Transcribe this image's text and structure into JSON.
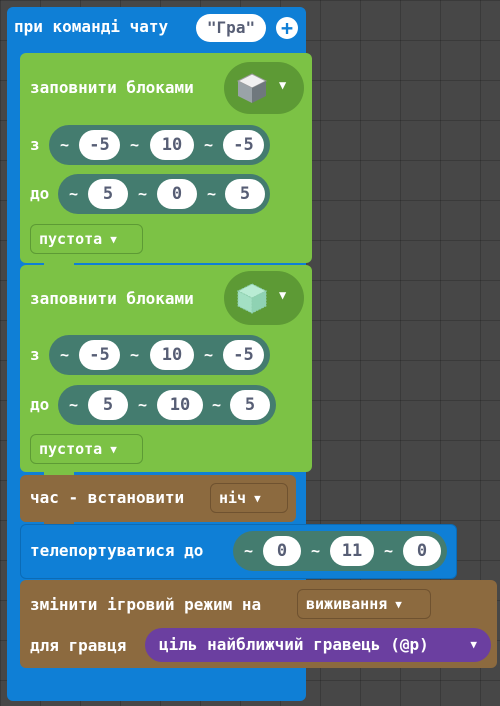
{
  "event": {
    "label": "при команді чату",
    "command": "Гра"
  },
  "fill1": {
    "label": "заповнити блоками",
    "block_icon": "grass-block-icon",
    "from_label": "з",
    "from": [
      "-5",
      "10",
      "-5"
    ],
    "to_label": "до",
    "to": [
      "5",
      "0",
      "5"
    ],
    "mode": "пустота"
  },
  "fill2": {
    "label": "заповнити блоками",
    "block_icon": "glass-block-icon",
    "from_label": "з",
    "from": [
      "-5",
      "10",
      "-5"
    ],
    "to_label": "до",
    "to": [
      "5",
      "10",
      "5"
    ],
    "mode": "пустота"
  },
  "time": {
    "label": "час - встановити",
    "value": "ніч"
  },
  "teleport": {
    "label": "телепортуватися до",
    "pos": [
      "0",
      "11",
      "0"
    ]
  },
  "gamemode": {
    "label": "змінити ігровий режим на",
    "value": "виживання",
    "player_label": "для гравця",
    "target": "ціль найближчий гравець (@p)"
  },
  "symbols": {
    "tilde": "~"
  },
  "colors": {
    "event": "#0f7fd6",
    "fill": "#7cc245",
    "game": "#8c6a3f",
    "position": "#447c6f",
    "target": "#6b3fa0"
  }
}
